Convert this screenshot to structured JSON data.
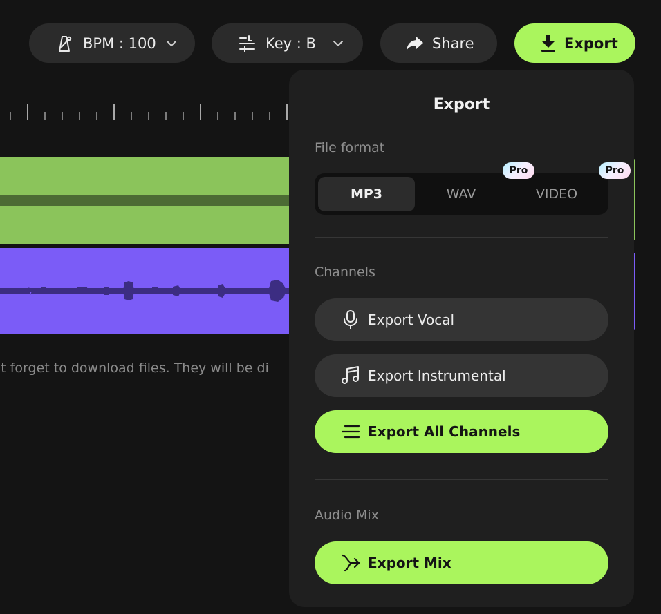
{
  "toolbar": {
    "bpm_label": "BPM : 100",
    "key_label": "Key : B",
    "share_label": "Share",
    "export_label": "Export"
  },
  "editor": {
    "notice": "'t forget to download files. They will be di"
  },
  "export_panel": {
    "title": "Export",
    "file_format": {
      "label": "File format",
      "options": [
        {
          "label": "MP3",
          "selected": true,
          "badge": ""
        },
        {
          "label": "WAV",
          "selected": false,
          "badge": "Pro"
        },
        {
          "label": "VIDEO",
          "selected": false,
          "badge": "Pro"
        }
      ]
    },
    "channels": {
      "label": "Channels",
      "vocal": "Export Vocal",
      "instrumental": "Export Instrumental",
      "all": "Export All Channels"
    },
    "audio_mix": {
      "label": "Audio Mix",
      "mix": "Export Mix"
    }
  },
  "colors": {
    "accent": "#aaf55d",
    "vocal_track": "#8bc45b",
    "instrumental_track": "#7b5cf7",
    "background": "#141414",
    "panel": "#1f1f1f"
  },
  "icons": {
    "bpm": "metronome-icon",
    "key": "key-adjust-icon",
    "share": "share-arrow-icon",
    "export": "download-icon",
    "vocal": "microphone-icon",
    "instrumental": "music-note-icon",
    "all": "lines-icon",
    "mix": "merge-arrow-icon"
  }
}
